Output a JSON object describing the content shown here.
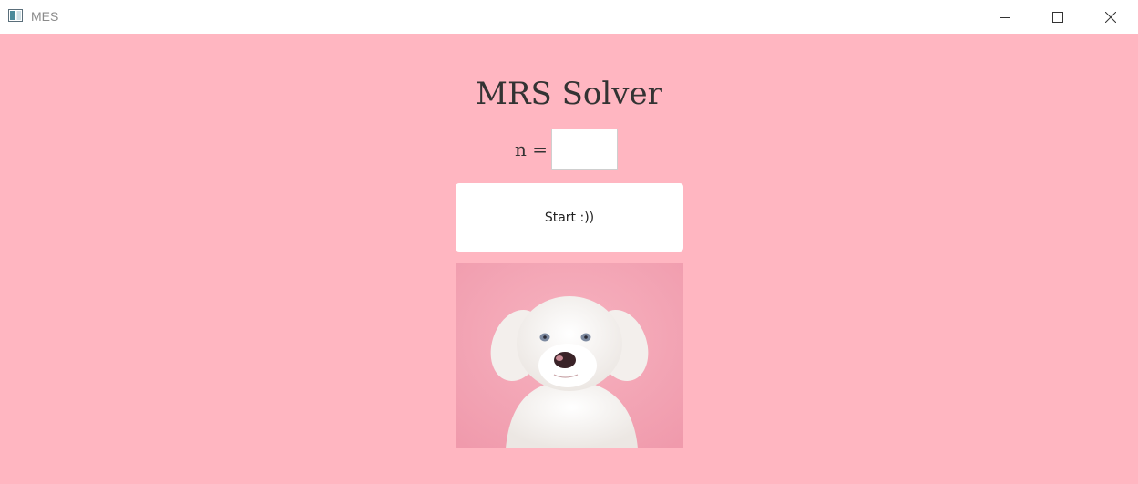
{
  "window": {
    "title": "MES",
    "controls": [
      "minimize-icon",
      "maximize-icon",
      "close-icon"
    ]
  },
  "main": {
    "heading": "MRS Solver",
    "n_label": "n =",
    "n_value": "",
    "start_label": "Start :))",
    "image_subject": "white puppy on pink background"
  },
  "colors": {
    "background": "#ffb6c1",
    "titlebar": "#ffffff",
    "button": "#ffffff",
    "text": "#333333"
  }
}
